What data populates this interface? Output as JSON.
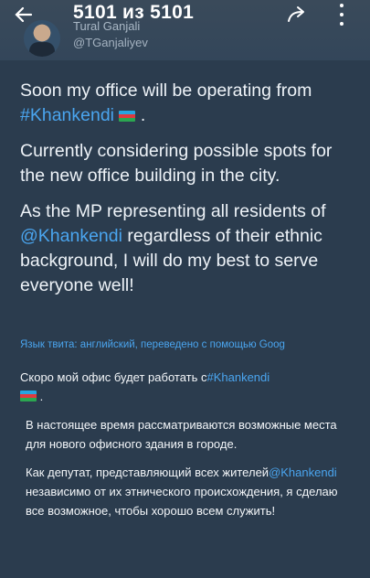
{
  "topbar": {
    "viewer_count": "5101 из 5101",
    "back_icon": "arrow-left-icon",
    "share_icon": "share-icon",
    "more_icon": "more-vertical-icon"
  },
  "author": {
    "name": "Tural Ganjali",
    "handle": "@TGanjaliyev"
  },
  "tweet_en": {
    "line1_pre": "Soon my office will be operating from",
    "line1_tag": "#Khankendi",
    "line1_post": ".",
    "para2": "Currently considering possible spots for the new office building in the city.",
    "para3_pre": "As the MP representing all residents of",
    "para3_mention": "@Khankendi",
    "para3_post": "regardless of their ethnic background, I will do my best to serve everyone well!"
  },
  "translation_note": "Язык твита: английский, переведено с помощью Goog",
  "tweet_ru": {
    "para1_pre": "Скоро мой офис будет работать с",
    "para1_tag": "#Khankendi",
    "para1_post": ".",
    "para2": "В настоящее время рассматриваются возможные места для нового офисного здания в городе.",
    "para3_pre": "Как депутат, представляющий всех жителей",
    "para3_mention": "@Khankendi",
    "para3_post": "независимо от их этнического происхождения, я сделаю все возможное, чтобы хорошо всем служить!"
  },
  "colors": {
    "background": "#2b3c4e",
    "link": "#4aa5ef",
    "text": "#eef3f8"
  }
}
